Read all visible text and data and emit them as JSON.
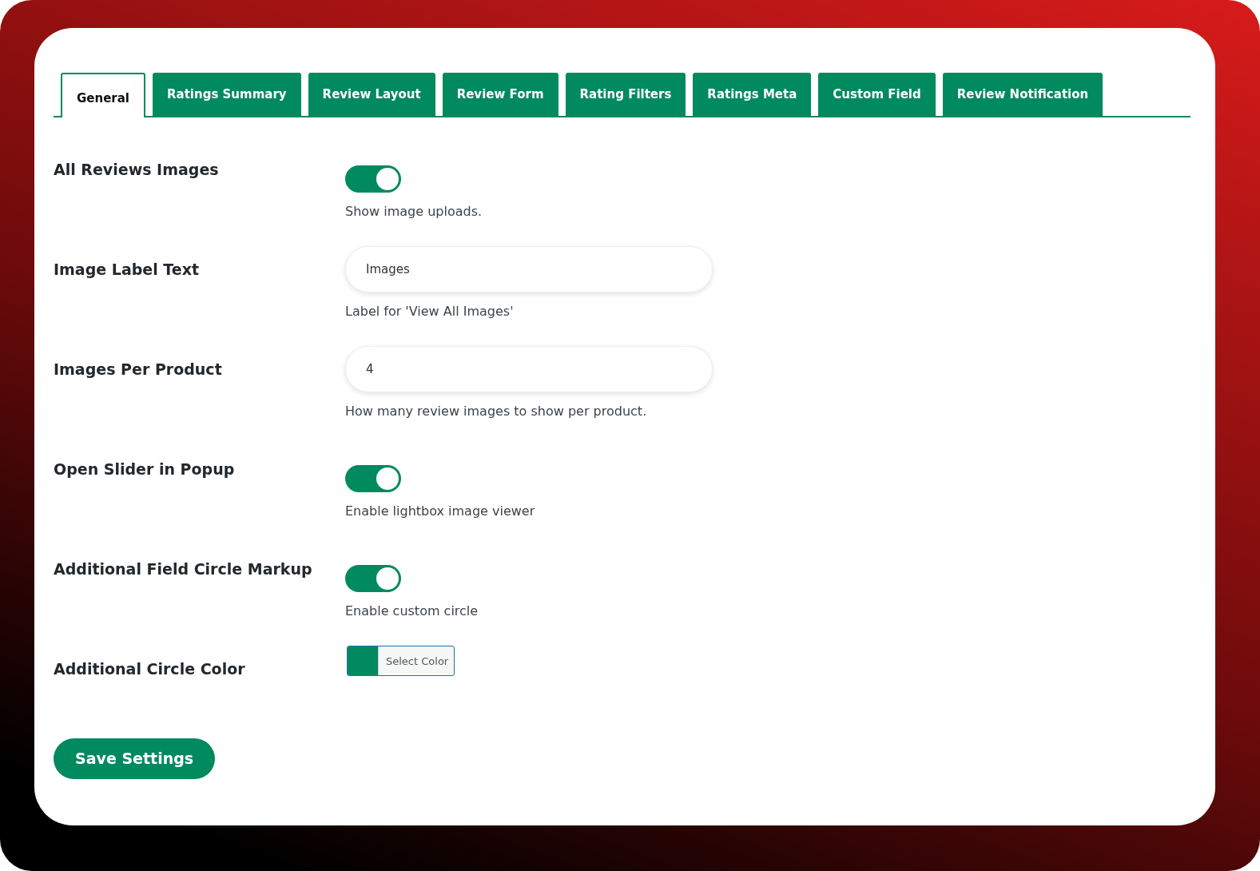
{
  "tabs": [
    {
      "label": "General",
      "selected": true
    },
    {
      "label": "Ratings Summary",
      "selected": false
    },
    {
      "label": "Review Layout",
      "selected": false
    },
    {
      "label": "Review Form",
      "selected": false
    },
    {
      "label": "Rating Filters",
      "selected": false
    },
    {
      "label": "Ratings Meta",
      "selected": false
    },
    {
      "label": "Custom Field",
      "selected": false
    },
    {
      "label": "Review Notification",
      "selected": false
    }
  ],
  "settings": [
    {
      "kind": "toggle",
      "label": "All Reviews Images",
      "on": true,
      "description": "Show image uploads."
    },
    {
      "kind": "text",
      "label": "Image Label Text",
      "value": "Images",
      "description": "Label for 'View All Images'"
    },
    {
      "kind": "text",
      "label": "Images Per Product",
      "value": "4",
      "description": "How many review images to show per product."
    },
    {
      "kind": "toggle",
      "label": "Open Slider in Popup",
      "on": true,
      "description": "Enable lightbox image viewer"
    },
    {
      "kind": "toggle",
      "label": "Additional Field Circle Markup",
      "on": true,
      "description": "Enable custom circle"
    },
    {
      "kind": "color",
      "label": "Additional Circle Color",
      "color": "#008a5e",
      "button": "Select Color"
    }
  ],
  "save_button": "Save Settings"
}
